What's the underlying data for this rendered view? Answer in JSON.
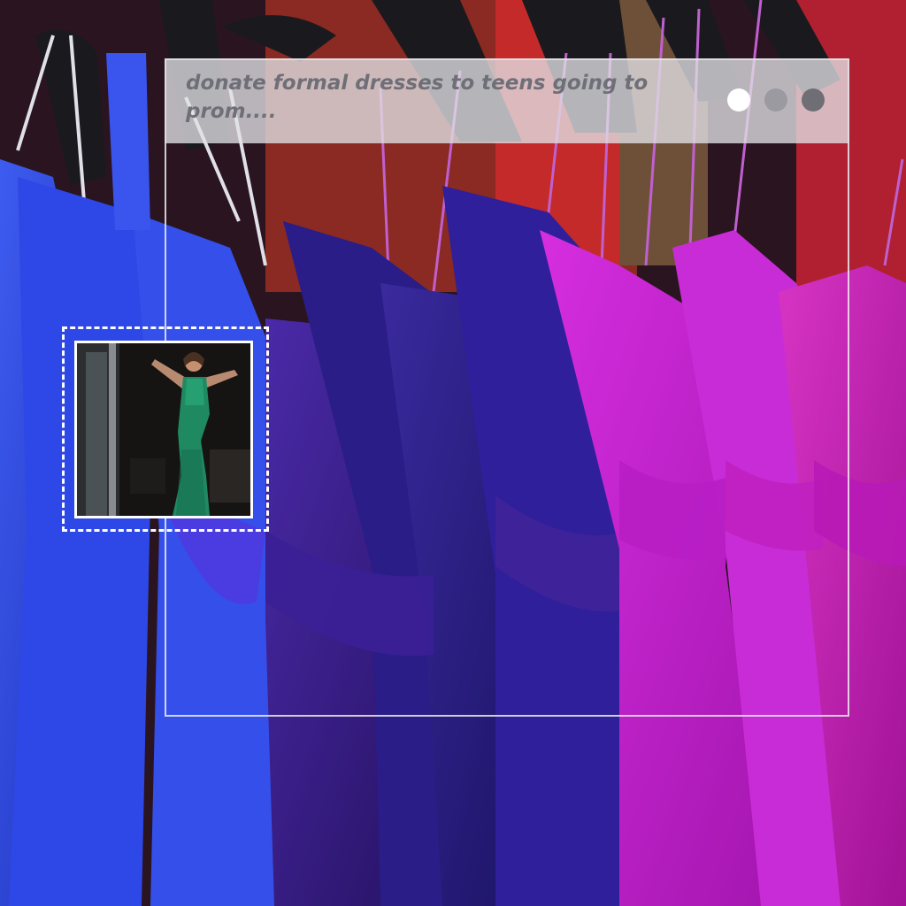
{
  "caption": {
    "text": "donate formal dresses to teens going to prom...."
  },
  "window_controls": {
    "colors": [
      "#ffffff",
      "#9a9aa0",
      "#6e6e74"
    ]
  },
  "photo": {
    "subject": "rack of formal dresses",
    "dress_colors": [
      "#2f3fd6",
      "#2a1f8a",
      "#3a1a8c",
      "#b21ec6",
      "#c81fb4"
    ]
  },
  "thumbnail": {
    "subject": "model in green sequin gown",
    "gown_color": "#1f8a62"
  }
}
